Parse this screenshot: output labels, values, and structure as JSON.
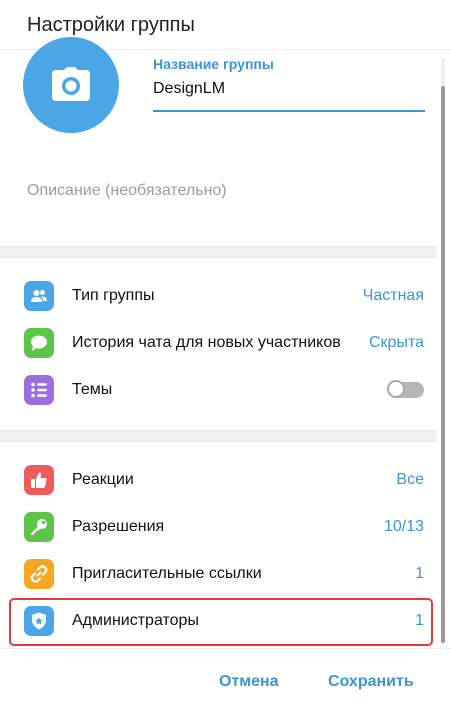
{
  "header": {
    "title": "Настройки группы"
  },
  "group": {
    "name_label": "Название группы",
    "name_value": "DesignLM",
    "description_placeholder": "Описание (необязательно)"
  },
  "section1": [
    {
      "label": "Тип группы",
      "value": "Частная",
      "icon": "people-icon",
      "icon_color": "#4aa6e4"
    },
    {
      "label": "История чата для новых участников",
      "value": "Скрыта",
      "icon": "chat-bubble-icon",
      "icon_color": "#5fc44a"
    },
    {
      "label": "Темы",
      "value": null,
      "icon": "topics-list-icon",
      "icon_color": "#9b6fe0",
      "toggle_on": false
    }
  ],
  "section2": [
    {
      "label": "Реакции",
      "value": "Все",
      "icon": "thumbs-up-icon",
      "icon_color": "#ef5b5b"
    },
    {
      "label": "Разрешения",
      "value": "10/13",
      "icon": "key-icon",
      "icon_color": "#5fc44a"
    },
    {
      "label": "Пригласительные ссылки",
      "value": "1",
      "icon": "link-icon",
      "icon_color": "#f5a623"
    },
    {
      "label": "Администраторы",
      "value": "1",
      "icon": "admin-shield-icon",
      "icon_color": "#4aa6e4"
    }
  ],
  "footer": {
    "cancel_label": "Отмена",
    "save_label": "Сохранить"
  },
  "colors": {
    "accent": "#3a95d5",
    "highlight_border": "#e23d3d"
  }
}
